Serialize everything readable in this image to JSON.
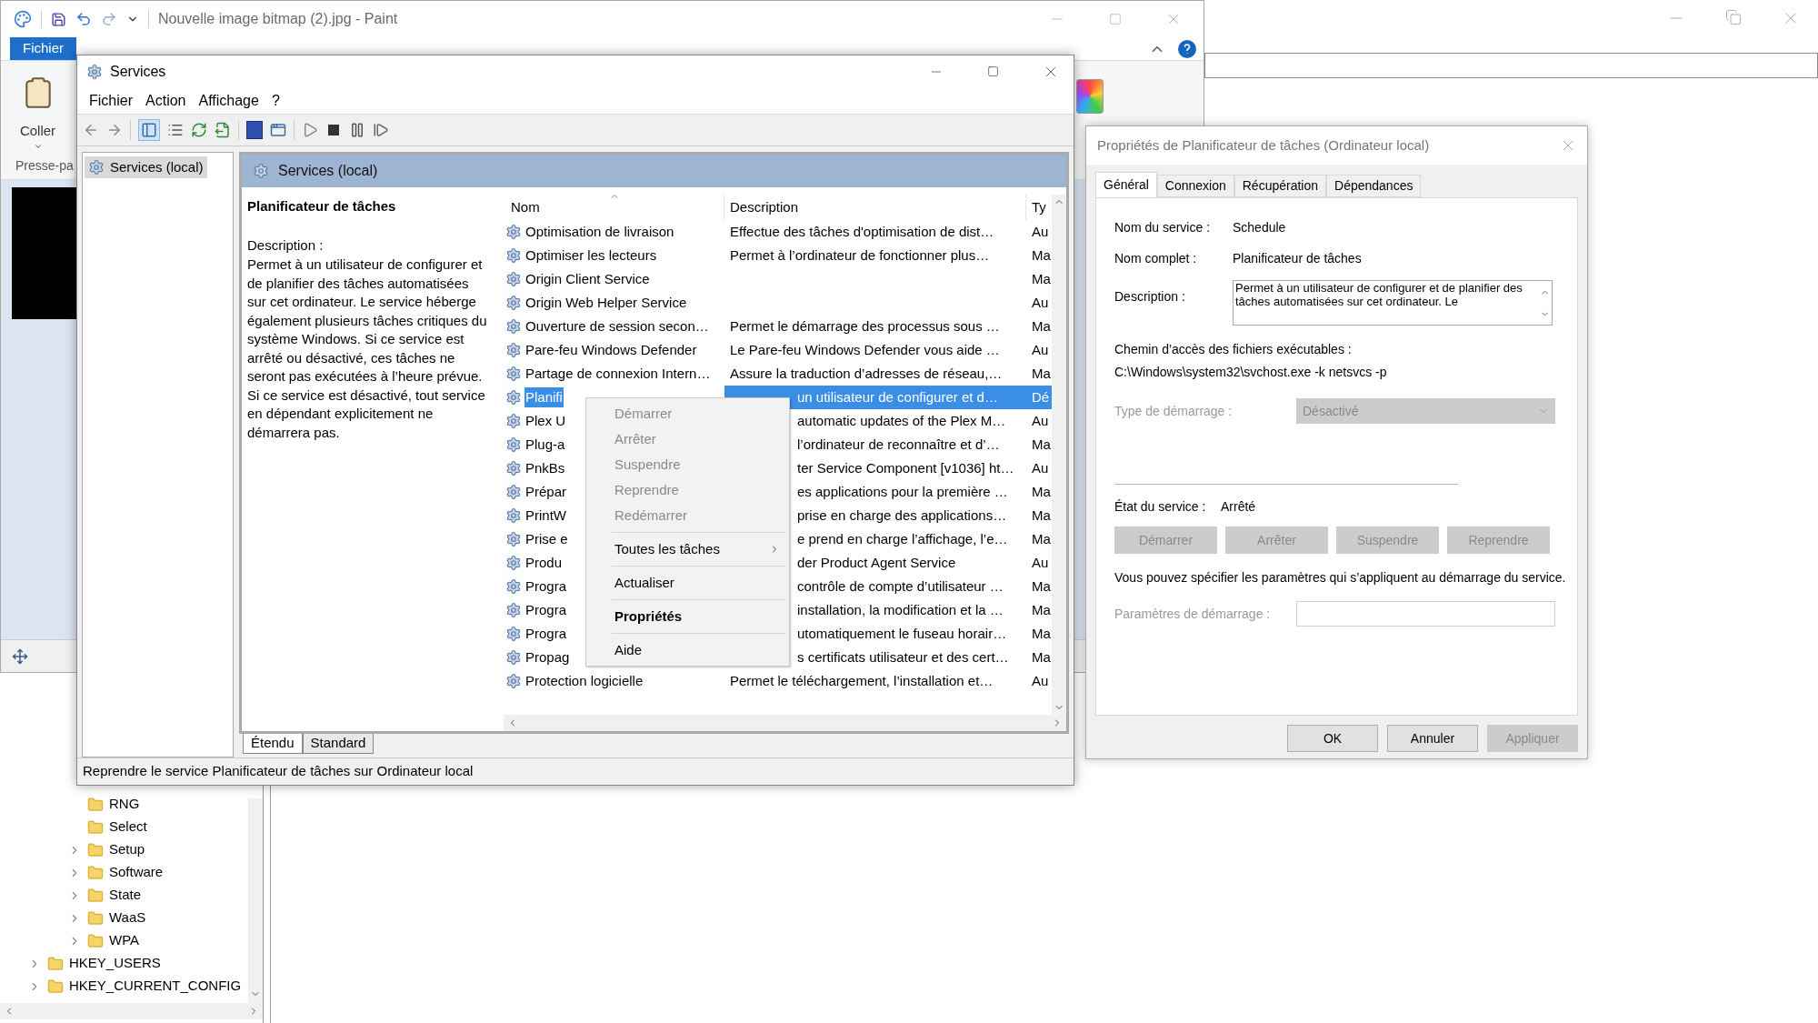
{
  "registry_window": {
    "tree": {
      "branch_items": [
        {
          "label": "RNG",
          "expandable": false
        },
        {
          "label": "Select",
          "expandable": false
        },
        {
          "label": "Setup",
          "expandable": true
        },
        {
          "label": "Software",
          "expandable": true
        },
        {
          "label": "State",
          "expandable": true
        },
        {
          "label": "WaaS",
          "expandable": true
        },
        {
          "label": "WPA",
          "expandable": true
        }
      ],
      "root_items": [
        {
          "label": "HKEY_USERS",
          "expandable": true
        },
        {
          "label": "HKEY_CURRENT_CONFIG",
          "expandable": true
        }
      ]
    }
  },
  "paint_window": {
    "title": "Nouvelle image bitmap (2).jpg - Paint",
    "file_tab": "Fichier",
    "paste_label": "Coller",
    "clipboard_group": "Presse-pa"
  },
  "services_window": {
    "title": "Services",
    "menu": [
      "Fichier",
      "Action",
      "Affichage",
      "?"
    ],
    "tree": [
      {
        "label": "Services (local)",
        "selected": true
      }
    ],
    "pane_title": "Services (local)",
    "detail": {
      "title": "Planificateur de tâches",
      "description_label": "Description :",
      "description": "Permet à un utilisateur de configurer et de planifier des tâches automatisées sur cet ordinateur. Le service héberge également plusieurs tâches critiques du système Windows. Si ce service est arrêté ou désactivé, ces tâches ne seront pas exécutées à l’heure prévue. Si ce service est désactivé, tout service en dépendant explicitement ne démarrera pas."
    },
    "table": {
      "columns": [
        "Nom",
        "Description",
        "Ty"
      ],
      "rows": [
        {
          "kind": "full",
          "name": "Optimisation de livraison",
          "description": "Effectue des tâches d'optimisation de dist…",
          "type": "Au",
          "selected": false
        },
        {
          "kind": "full",
          "name": "Optimiser les lecteurs",
          "description": "Permet à l’ordinateur de fonctionner plus…",
          "type": "Ma",
          "selected": false
        },
        {
          "kind": "full",
          "name": "Origin Client Service",
          "type": "Ma",
          "selected": false
        },
        {
          "kind": "full",
          "name": "Origin Web Helper Service",
          "type": "Au",
          "selected": false
        },
        {
          "kind": "full",
          "name": "Ouverture de session secon…",
          "description": "Permet le démarrage des processus sous …",
          "type": "Ma",
          "selected": false
        },
        {
          "kind": "full",
          "name": "Pare-feu Windows Defender",
          "description": "Le Pare-feu Windows Defender vous aide …",
          "type": "Au",
          "selected": false
        },
        {
          "kind": "full",
          "name": "Partage de connexion Intern…",
          "description": "Assure la traduction d’adresses de réseau,…",
          "type": "Ma",
          "selected": false
        },
        {
          "kind": "overlapped",
          "name": "Planifi",
          "description": "un utilisateur de configurer et d…",
          "type": "Dé",
          "selected": true
        },
        {
          "kind": "overlapped",
          "name": "Plex U",
          "description": "automatic updates of the Plex M…",
          "type": "Au",
          "selected": false
        },
        {
          "kind": "overlapped",
          "name": "Plug-a",
          "description": "l’ordinateur de reconnaître et d’…",
          "type": "Ma",
          "selected": false
        },
        {
          "kind": "overlapped",
          "name": "PnkBs",
          "description": "ter Service Component [v1036] ht…",
          "type": "Au",
          "selected": false
        },
        {
          "kind": "overlapped",
          "name": "Prépar",
          "description": "es applications pour la première …",
          "type": "Ma",
          "selected": false
        },
        {
          "kind": "overlapped",
          "name": "PrintW",
          "description": "prise en charge des applications…",
          "type": "Ma",
          "selected": false
        },
        {
          "kind": "overlapped",
          "name": "Prise e",
          "description": "e prend en charge l’affichage, l’e…",
          "type": "Ma",
          "selected": false
        },
        {
          "kind": "overlapped",
          "name": "Produ",
          "description": "der Product Agent Service",
          "type": "Au",
          "selected": false
        },
        {
          "kind": "overlapped",
          "name": "Progra",
          "description": "contrôle de compte d’utilisateur …",
          "type": "Ma",
          "selected": false
        },
        {
          "kind": "overlapped",
          "name": "Progra",
          "description": "installation, la modification et la …",
          "type": "Ma",
          "selected": false
        },
        {
          "kind": "overlapped",
          "name": "Progra",
          "description": "utomatiquement le fuseau horair…",
          "type": "Ma",
          "selected": false
        },
        {
          "kind": "overlapped",
          "name": "Propag",
          "description": "s certificats utilisateur et des cert…",
          "type": "Ma",
          "selected": false
        },
        {
          "kind": "full",
          "name": "Protection logicielle",
          "description": "Permet le téléchargement, l’installation et…",
          "type": "Au",
          "selected": false
        }
      ]
    },
    "view_tabs": [
      {
        "label": "Étendu",
        "selected": true
      },
      {
        "label": "Standard",
        "selected": false
      }
    ],
    "status_bar": "Reprendre le service Planificateur de tâches sur Ordinateur local"
  },
  "context_menu": {
    "items": [
      {
        "kind": "item",
        "label": "Démarrer",
        "disabled": true,
        "default": false
      },
      {
        "kind": "item",
        "label": "Arrêter",
        "disabled": true,
        "default": false
      },
      {
        "kind": "item",
        "label": "Suspendre",
        "disabled": true,
        "default": false
      },
      {
        "kind": "item",
        "label": "Reprendre",
        "disabled": true,
        "default": false
      },
      {
        "kind": "item",
        "label": "Redémarrer",
        "disabled": true,
        "default": false
      },
      {
        "kind": "separator"
      },
      {
        "kind": "submenu",
        "label": "Toutes les tâches",
        "disabled": false,
        "default": false
      },
      {
        "kind": "separator"
      },
      {
        "kind": "item",
        "label": "Actualiser",
        "disabled": false,
        "default": false
      },
      {
        "kind": "separator"
      },
      {
        "kind": "item",
        "label": "Propriétés",
        "disabled": false,
        "default": true
      },
      {
        "kind": "separator"
      },
      {
        "kind": "item",
        "label": "Aide",
        "disabled": false,
        "default": false
      }
    ]
  },
  "properties_dialog": {
    "title": "Propriétés de Planificateur de tâches (Ordinateur local)",
    "tabs": [
      {
        "label": "Général",
        "selected": true
      },
      {
        "label": "Connexion",
        "selected": false
      },
      {
        "label": "Récupération",
        "selected": false
      },
      {
        "label": "Dépendances",
        "selected": false
      }
    ],
    "service_name_label": "Nom du service :",
    "service_name": "Schedule",
    "display_name_label": "Nom complet :",
    "display_name": "Planificateur de tâches",
    "description_label": "Description :",
    "description": "Permet à un utilisateur de configurer et de planifier des tâches automatisées sur cet ordinateur. Le",
    "path_label": "Chemin d’accès des fichiers exécutables :",
    "path": "C:\\Windows\\system32\\svchost.exe -k netsvcs -p",
    "startup_type_label": "Type de démarrage :",
    "startup_type": "Désactivé",
    "startup_type_disabled": true,
    "status_label": "État du service :",
    "status": "Arrêté",
    "service_buttons": [
      {
        "label": "Démarrer",
        "disabled": true
      },
      {
        "label": "Arrêter",
        "disabled": true
      },
      {
        "label": "Suspendre",
        "disabled": true
      },
      {
        "label": "Reprendre",
        "disabled": true
      }
    ],
    "params_hint": "Vous pouvez spécifier les paramètres qui s’appliquent au démarrage du service.",
    "params_label": "Paramètres de démarrage :",
    "params_disabled": true,
    "buttons": [
      {
        "label": "OK",
        "disabled": false
      },
      {
        "label": "Annuler",
        "disabled": false
      },
      {
        "label": "Appliquer",
        "disabled": true
      }
    ]
  }
}
